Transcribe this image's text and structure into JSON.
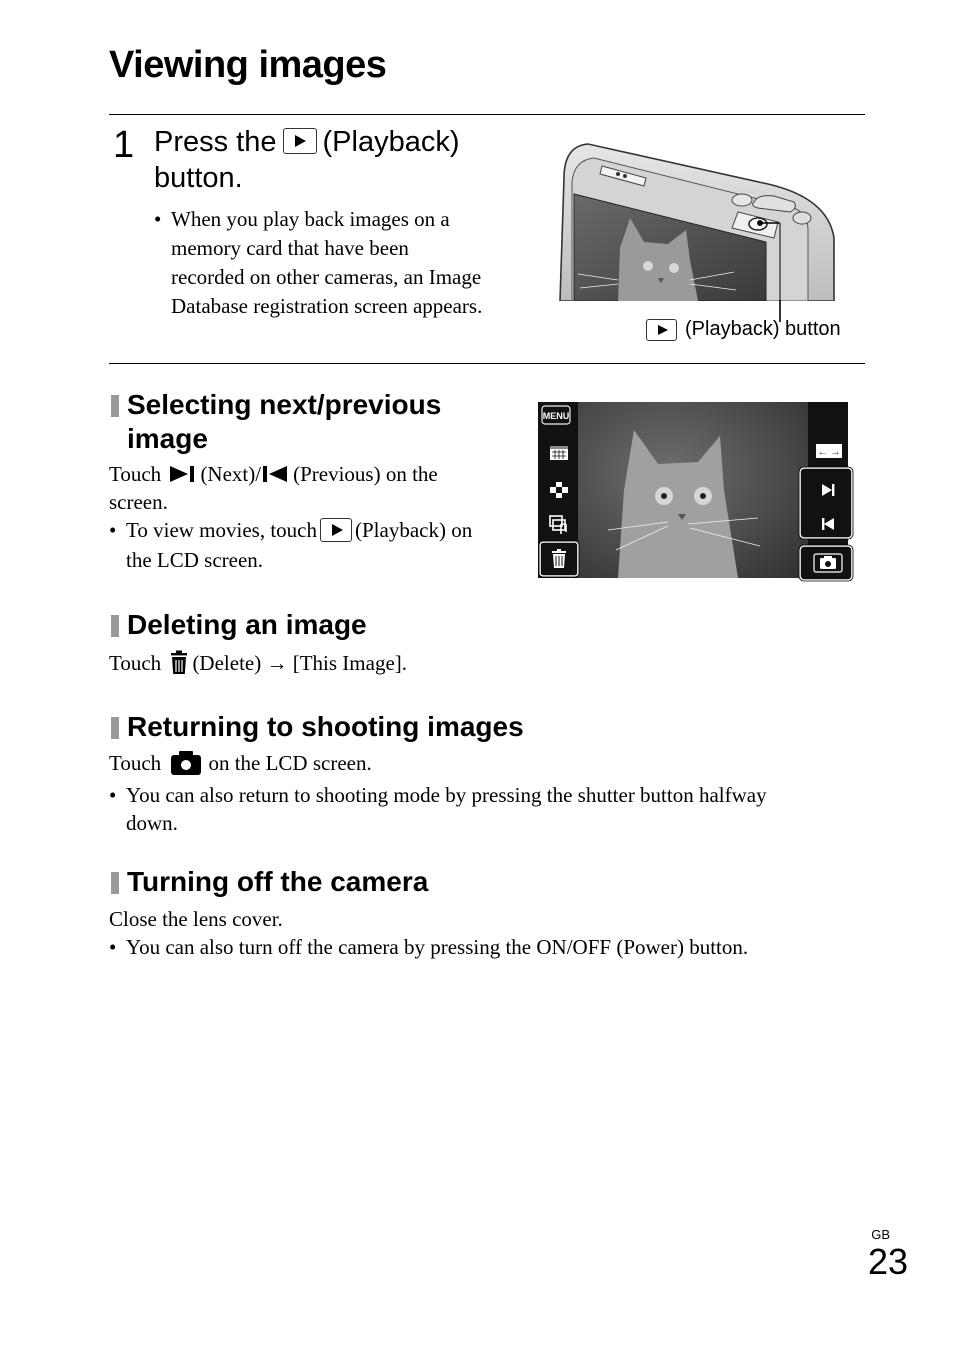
{
  "page": {
    "title": "Viewing images",
    "region": "GB",
    "number": "23"
  },
  "step1": {
    "number": "1",
    "title_before": "Press the",
    "title_after": "(Playback)",
    "title_line2": "button.",
    "button_icon": "playback-icon",
    "note_bullet": "•",
    "note_lines": [
      "When you play back images on a",
      "memory card that have been",
      "recorded on other cameras, an Image",
      "Database registration screen appears."
    ]
  },
  "camera_illustration": {
    "caption": "(Playback) button",
    "caption_icon": "playback-icon"
  },
  "lcd_screen": {
    "left_buttons": [
      {
        "name": "menu-button",
        "label": "MENU",
        "icon": "menu-icon"
      },
      {
        "name": "calendar-view-button",
        "label": "",
        "icon": "calendar-icon"
      },
      {
        "name": "index-view-button",
        "label": "",
        "icon": "index-grid-icon"
      },
      {
        "name": "slideshow-button",
        "label": "",
        "icon": "slideshow-music-icon"
      },
      {
        "name": "delete-button",
        "label": "",
        "icon": "trash-icon",
        "highlighted": true
      }
    ],
    "right_buttons": [
      {
        "name": "scroll-button",
        "label": "← →",
        "icon": "scroll-arrows-icon"
      },
      {
        "name": "next-button",
        "label": "",
        "icon": "next-icon",
        "highlighted": true
      },
      {
        "name": "previous-button",
        "label": "",
        "icon": "previous-icon",
        "highlighted": true
      },
      {
        "name": "shooting-mode-button",
        "label": "",
        "icon": "camera-icon",
        "highlighted": true
      }
    ]
  },
  "sections": {
    "next_prev": {
      "heading_line1": "Selecting next/previous",
      "heading_line2": "image",
      "line1_touch": "Touch",
      "line1_next": "(Next)/",
      "line1_prev": "(Previous) on the",
      "line2": "screen.",
      "bullet": "•",
      "bullet_before": "To view movies, touch",
      "bullet_after": "(Playback) on",
      "bullet_line2": "the LCD screen."
    },
    "deleting": {
      "heading": "Deleting an image",
      "touch": "Touch",
      "text": "(Delete)",
      "arrow": "→",
      "target": "[This Image]."
    },
    "returning": {
      "heading": "Returning to shooting images",
      "touch": "Touch",
      "text": "on the LCD screen.",
      "bullet": "•",
      "bullet_line1": "You can also return to shooting mode by pressing the shutter button halfway",
      "bullet_line2": "down."
    },
    "turning_off": {
      "heading": "Turning off the camera",
      "text": "Close the lens cover.",
      "bullet": "•",
      "bullet_text": "You can also turn off the camera by pressing the ON/OFF (Power) button."
    }
  }
}
